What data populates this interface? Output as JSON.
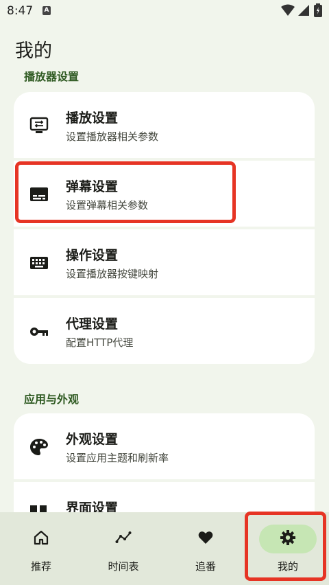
{
  "status": {
    "time": "8:47",
    "notification_letter": "A"
  },
  "page": {
    "title": "我的"
  },
  "sections": [
    {
      "label": "播放器设置",
      "items": [
        {
          "title": "播放设置",
          "subtitle": "设置播放器相关参数",
          "icon": "display-settings-icon"
        },
        {
          "title": "弹幕设置",
          "subtitle": "设置弹幕相关参数",
          "icon": "subtitles-icon"
        },
        {
          "title": "操作设置",
          "subtitle": "设置播放器按键映射",
          "icon": "keyboard-icon"
        },
        {
          "title": "代理设置",
          "subtitle": "配置HTTP代理",
          "icon": "key-icon"
        }
      ]
    },
    {
      "label": "应用与外观",
      "items": [
        {
          "title": "外观设置",
          "subtitle": "设置应用主题和刷新率",
          "icon": "palette-icon"
        },
        {
          "title": "界面设置",
          "subtitle": "",
          "icon": "layout-icon"
        }
      ]
    }
  ],
  "nav": [
    {
      "label": "推荐",
      "icon": "home-icon",
      "active": false
    },
    {
      "label": "时间表",
      "icon": "timeline-icon",
      "active": false
    },
    {
      "label": "追番",
      "icon": "heart-icon",
      "active": false
    },
    {
      "label": "我的",
      "icon": "gear-icon",
      "active": true
    }
  ],
  "colors": {
    "accent": "#2f5a22",
    "highlight": "#e63424",
    "nav_bg": "#e2e8da",
    "active_pill": "#c6e6b4"
  }
}
